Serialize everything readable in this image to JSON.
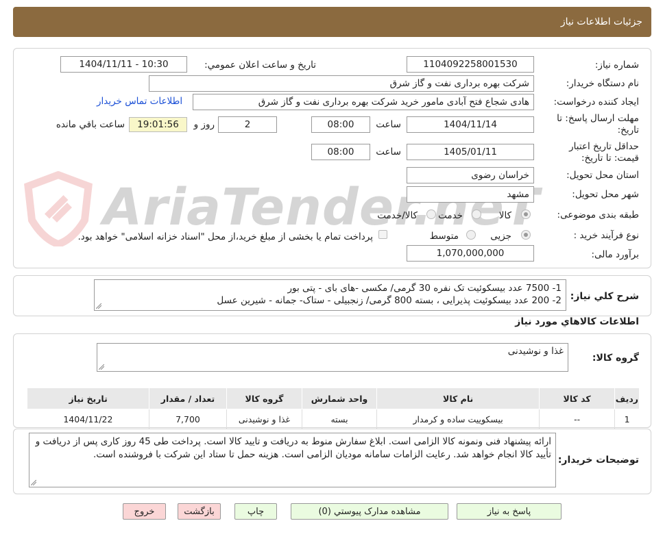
{
  "header": {
    "title": "جزئیات اطلاعات نیاز",
    "bg": "#8b6a3f"
  },
  "form": {
    "need_number_label": "شماره نیاز:",
    "need_number": "1104092258001530",
    "announce_label": "تاریخ و ساعت اعلان عمومي:",
    "announce_value": "1404/11/11 - 10:30",
    "buyer_label": "نام دستگاه خريدار:",
    "buyer_value": "شرکت بهره برداری نفت و گاز شرق",
    "creator_label": "ايجاد کننده درخواست:",
    "creator_value": "هادی شجاع فتح آبادی مامور خرید شرکت بهره برداری نفت و گاز شرق",
    "contact_link": "اطلاعات تماس خريدار",
    "reply_label_1": "مهلت ارسال پاسخ: تا",
    "reply_label_2": "تاریخ:",
    "reply_date": "1404/11/14",
    "time_label": "ساعت",
    "reply_time": "08:00",
    "days_value": "2",
    "days_label": "روز و",
    "remaining_time": "19:01:56",
    "remaining_label": "ساعت باقي مانده",
    "validity_label_1": "حداقل تاريخ اعتبار",
    "validity_label_2": "قيمت: تا تاريخ:",
    "validity_date": "1405/01/11",
    "validity_time": "08:00",
    "province_label": "استان محل تحويل:",
    "province_value": "خراسان رضوی",
    "city_label": "شهر محل تحويل:",
    "city_value": "مشهد",
    "category_label": "طبقه بندی موضوعی:",
    "category_options": [
      "کالا",
      "خدمت",
      "کالا/خدمت"
    ],
    "process_label": "نوع فرآیند خرید :",
    "process_options": [
      "جزیی",
      "متوسط"
    ],
    "payment_note": "پرداخت تمام یا بخشی از مبلغ خرید،از محل \"اسناد خزانه اسلامی\" خواهد بود.",
    "budget_label": "برآورد مالی:",
    "budget_value": "1,070,000,000"
  },
  "summary": {
    "label": "شرح کلي نياز:",
    "lines": [
      "1- 7500 عدد بیسکوئیت تک نفره 30 گرمی/ مکسی -های بای - پتی بور",
      "2- 200 عدد بیسکوئیت پذیرایی ، بسته 800 گرمی/ زنجبیلی - ستاک- جمانه - شیرین عسل"
    ]
  },
  "goods": {
    "section_title": "اطلاعات کالاهاي مورد نياز",
    "group_label": "گروه کالا:",
    "group_value": "غذا و نوشیدنی",
    "columns": [
      "رديف",
      "کد کالا",
      "نام کالا",
      "واحد شمارش",
      "گروه کالا",
      "تعداد / مقدار",
      "تاريخ نياز"
    ],
    "rows": [
      [
        "1",
        "--",
        "بیسکوییت ساده و کرمدار",
        "بسته",
        "غذا و نوشیدنی",
        "7,700",
        "1404/11/22"
      ]
    ]
  },
  "buyer_notes": {
    "label": "توضيحات خريدار:",
    "text": "ارائه پیشنهاد فنی ونمونه کالا الزامی است. ابلاغ سفارش منوط به دریافت و تایید کالا است. پرداخت طی  45 روز کاری پس از دریافت و تأیید کالا انجام خواهد شد. رعایت الزامات سامانه مودیان الزامی است. هزینه حمل تا ستاد این شرکت با فروشنده است."
  },
  "buttons": {
    "reply": "پاسخ به نياز",
    "attachments": "مشاهده مدارک پیوستي (0)",
    "print": "چاپ",
    "back": "بازگشت",
    "exit": "خروج"
  },
  "watermark": "AriaTender.neT"
}
